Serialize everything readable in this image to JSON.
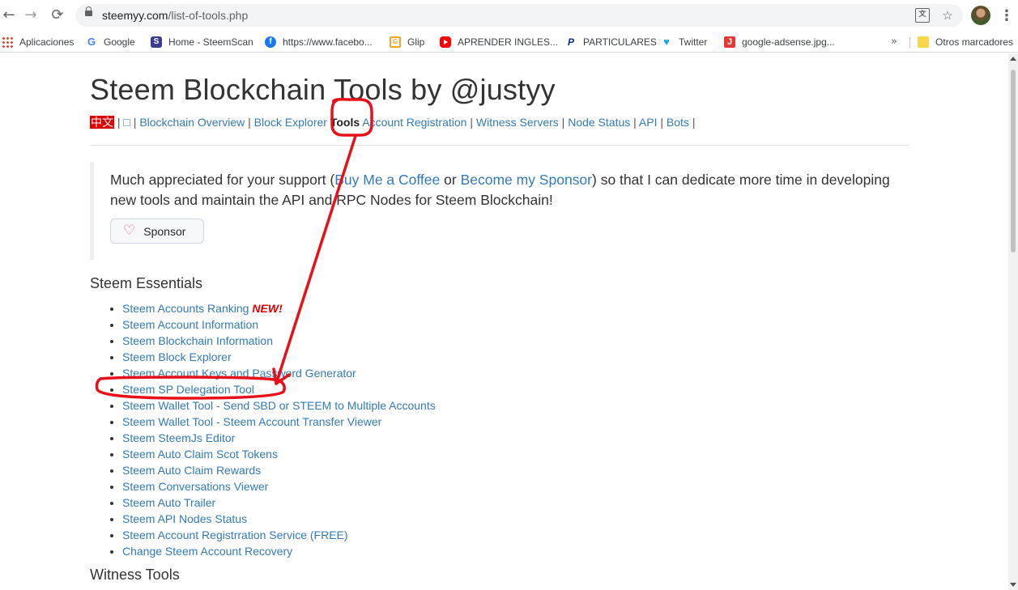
{
  "browser": {
    "url_domain": "steemyy.com",
    "url_path": "/list-of-tools.php",
    "back_glyph": "←",
    "forward_glyph": "→",
    "reload_glyph": "⟳",
    "translate_glyph": "文",
    "star_glyph": "☆",
    "menu_glyph": "⋮"
  },
  "bookmarks": {
    "items": [
      {
        "label": "Aplicaciones",
        "icon": "apps-grid-icon"
      },
      {
        "label": "Google",
        "icon": "google-icon",
        "glyph": "G"
      },
      {
        "label": "Home - SteemScan",
        "icon": "steemscan-icon",
        "glyph": "S"
      },
      {
        "label": "https://www.facebo...",
        "icon": "facebook-icon",
        "glyph": "f"
      },
      {
        "label": "Glip",
        "icon": "glip-icon",
        "glyph": "G"
      },
      {
        "label": "APRENDER INGLES...",
        "icon": "youtube-icon"
      },
      {
        "label": "PARTICULARES",
        "icon": "paypal-icon",
        "glyph": "P"
      },
      {
        "label": "Twitter",
        "icon": "twitter-icon",
        "glyph": "♥"
      },
      {
        "label": "google-adsense.jpg...",
        "icon": "jpg-icon",
        "glyph": "J"
      }
    ],
    "more_glyph": "»",
    "other_label": "Otros marcadores"
  },
  "page": {
    "title": "Steem Blockchain Tools by @justyy",
    "nav": {
      "zh": "中文",
      "box": "□",
      "sep": " | ",
      "links": [
        "Blockchain Overview",
        "Block Explorer",
        "Tools",
        "Account Registration",
        "Witness Servers",
        "Node Status",
        "API",
        "Bots"
      ],
      "current_index": 2
    },
    "notice": {
      "pre": "Much appreciated for your support (",
      "link1": "Buy Me a Coffee",
      "mid": " or ",
      "link2": "Become my Sponsor",
      "post": ") so that I can dedicate more time in developing new tools and maintain the API and RPC Nodes for Steem Blockchain!",
      "sponsor_label": "Sponsor",
      "heart_glyph": "♡"
    },
    "essentials_heading": "Steem Essentials",
    "new_badge": "NEW!",
    "tools": [
      "Steem Accounts Ranking",
      "Steem Account Information",
      "Steem Blockchain Information",
      "Steem Block Explorer",
      "Steem Account Keys and Password Generator",
      "Steem SP Delegation Tool",
      "Steem Wallet Tool - Send SBD or STEEM to Multiple Accounts",
      "Steem Wallet Tool - Steem Account Transfer Viewer",
      "Steem SteemJs Editor",
      "Steem Auto Claim Scot Tokens",
      "Steem Auto Claim Rewards",
      "Steem Conversations Viewer",
      "Steem Auto Trailer",
      "Steem API Nodes Status",
      "Steem Account Registrration Service (FREE)",
      "Change Steem Account Recovery"
    ],
    "witness_heading": "Witness Tools"
  },
  "annotation": {
    "color": "#e8111a"
  }
}
